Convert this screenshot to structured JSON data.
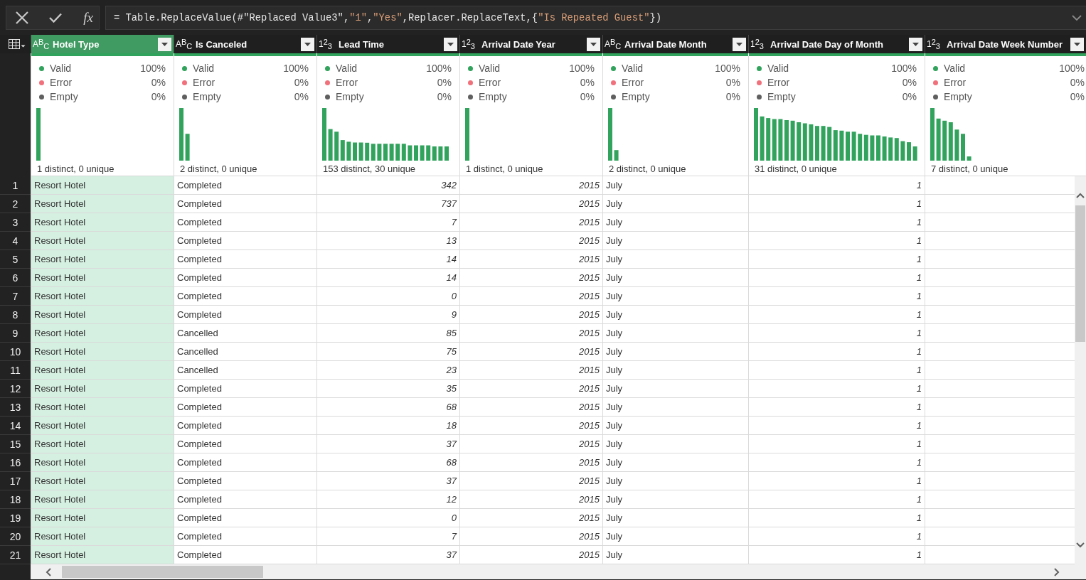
{
  "formula_bar": {
    "buttons": [
      {
        "kind": "cancel"
      },
      {
        "kind": "commit"
      },
      {
        "kind": "function",
        "label": "fx"
      }
    ],
    "formula": "= Table.ReplaceValue(#\"Replaced Value3\",\"1\",\"Yes\",Replacer.ReplaceText,{\"Is Repeated Guest\"})"
  },
  "table": {
    "columns": [
      {
        "name": "Hotel Type",
        "kind": "text",
        "type_label": "A$^{B}$$_{C}$",
        "selected": true,
        "profile": {
          "stats": [
            {
              "label": "Valid",
              "value": "100%",
              "color": "#31a35c"
            },
            {
              "label": "Error",
              "value": "0%",
              "color": "#f0717c"
            },
            {
              "label": "Empty",
              "value": "0%",
              "color": "#5f5f5f"
            }
          ],
          "summary": "1 distinct, 0 unique"
        }
      },
      {
        "name": "Is Canceled",
        "kind": "text",
        "type_label": "A$^{B}$$_{C}$",
        "selected": false,
        "profile": {
          "stats": [
            {
              "label": "Valid",
              "value": "100%",
              "color": "#31a35c"
            },
            {
              "label": "Error",
              "value": "0%",
              "color": "#f0717c"
            },
            {
              "label": "Empty",
              "value": "0%",
              "color": "#5f5f5f"
            }
          ],
          "summary": "2 distinct, 0 unique"
        }
      },
      {
        "name": "Lead Time",
        "kind": "number",
        "type_label": "1$^{2}$$_{3}$",
        "selected": false,
        "profile": {
          "stats": [
            {
              "label": "Valid",
              "value": "100%",
              "color": "#31a35c"
            },
            {
              "label": "Error",
              "value": "0%",
              "color": "#f0717c"
            },
            {
              "label": "Empty",
              "value": "0%",
              "color": "#5f5f5f"
            }
          ],
          "summary": "153 distinct, 30 unique"
        }
      },
      {
        "name": "Arrival Date Year",
        "kind": "number",
        "type_label": "1$^{2}$$_{3}$",
        "selected": false,
        "profile": {
          "stats": [
            {
              "label": "Valid",
              "value": "100%",
              "color": "#31a35c"
            },
            {
              "label": "Error",
              "value": "0%",
              "color": "#f0717c"
            },
            {
              "label": "Empty",
              "value": "0%",
              "color": "#5f5f5f"
            }
          ],
          "summary": "1 distinct, 0 unique"
        }
      },
      {
        "name": "Arrival Date Month",
        "kind": "text",
        "type_label": "A$^{B}$$_{C}$",
        "selected": false,
        "profile": {
          "stats": [
            {
              "label": "Valid",
              "value": "100%",
              "color": "#31a35c"
            },
            {
              "label": "Error",
              "value": "0%",
              "color": "#f0717c"
            },
            {
              "label": "Empty",
              "value": "0%",
              "color": "#5f5f5f"
            }
          ],
          "summary": "2 distinct, 0 unique"
        }
      },
      {
        "name": "Arrival Date Day of Month",
        "kind": "number",
        "type_label": "1$^{2}$$_{3}$",
        "selected": false,
        "profile": {
          "stats": [
            {
              "label": "Valid",
              "value": "100%",
              "color": "#31a35c"
            },
            {
              "label": "Error",
              "value": "0%",
              "color": "#f0717c"
            },
            {
              "label": "Empty",
              "value": "0%",
              "color": "#5f5f5f"
            }
          ],
          "summary": "31 distinct, 0 unique"
        }
      },
      {
        "name": "Arrival Date Week Number",
        "kind": "number",
        "type_label": "1$^{2}$$_{3}$",
        "selected": false,
        "profile": {
          "stats": [
            {
              "label": "Valid",
              "value": "100%",
              "color": "#31a35c"
            },
            {
              "label": "Error",
              "value": "0%",
              "color": "#f0717c"
            },
            {
              "label": "Empty",
              "value": "0%",
              "color": "#5f5f5f"
            }
          ],
          "summary": "7 distinct, 0 unique"
        }
      }
    ],
    "rows": [
      {
        "number": "1",
        "cells": [
          "Resort Hotel",
          "Completed",
          "342",
          "2015",
          "July",
          "1"
        ]
      },
      {
        "number": "2",
        "cells": [
          "Resort Hotel",
          "Completed",
          "737",
          "2015",
          "July",
          "1"
        ]
      },
      {
        "number": "3",
        "cells": [
          "Resort Hotel",
          "Completed",
          "7",
          "2015",
          "July",
          "1"
        ]
      },
      {
        "number": "4",
        "cells": [
          "Resort Hotel",
          "Completed",
          "13",
          "2015",
          "July",
          "1"
        ]
      },
      {
        "number": "5",
        "cells": [
          "Resort Hotel",
          "Completed",
          "14",
          "2015",
          "July",
          "1"
        ]
      },
      {
        "number": "6",
        "cells": [
          "Resort Hotel",
          "Completed",
          "14",
          "2015",
          "July",
          "1"
        ]
      },
      {
        "number": "7",
        "cells": [
          "Resort Hotel",
          "Completed",
          "0",
          "2015",
          "July",
          "1"
        ]
      },
      {
        "number": "8",
        "cells": [
          "Resort Hotel",
          "Completed",
          "9",
          "2015",
          "July",
          "1"
        ]
      },
      {
        "number": "9",
        "cells": [
          "Resort Hotel",
          "Cancelled",
          "85",
          "2015",
          "July",
          "1"
        ]
      },
      {
        "number": "10",
        "cells": [
          "Resort Hotel",
          "Cancelled",
          "75",
          "2015",
          "July",
          "1"
        ]
      },
      {
        "number": "11",
        "cells": [
          "Resort Hotel",
          "Cancelled",
          "23",
          "2015",
          "July",
          "1"
        ]
      },
      {
        "number": "12",
        "cells": [
          "Resort Hotel",
          "Completed",
          "35",
          "2015",
          "July",
          "1"
        ]
      },
      {
        "number": "13",
        "cells": [
          "Resort Hotel",
          "Completed",
          "68",
          "2015",
          "July",
          "1"
        ]
      },
      {
        "number": "14",
        "cells": [
          "Resort Hotel",
          "Completed",
          "18",
          "2015",
          "July",
          "1"
        ]
      },
      {
        "number": "15",
        "cells": [
          "Resort Hotel",
          "Completed",
          "37",
          "2015",
          "July",
          "1"
        ]
      },
      {
        "number": "16",
        "cells": [
          "Resort Hotel",
          "Completed",
          "68",
          "2015",
          "July",
          "1"
        ]
      },
      {
        "number": "17",
        "cells": [
          "Resort Hotel",
          "Completed",
          "37",
          "2015",
          "July",
          "1"
        ]
      },
      {
        "number": "18",
        "cells": [
          "Resort Hotel",
          "Completed",
          "12",
          "2015",
          "July",
          "1"
        ]
      },
      {
        "number": "19",
        "cells": [
          "Resort Hotel",
          "Completed",
          "0",
          "2015",
          "July",
          "1"
        ]
      },
      {
        "number": "20",
        "cells": [
          "Resort Hotel",
          "Completed",
          "7",
          "2015",
          "July",
          "1"
        ]
      },
      {
        "number": "21",
        "cells": [
          "Resort Hotel",
          "Completed",
          "37",
          "2015",
          "July",
          "1"
        ]
      }
    ]
  }
}
